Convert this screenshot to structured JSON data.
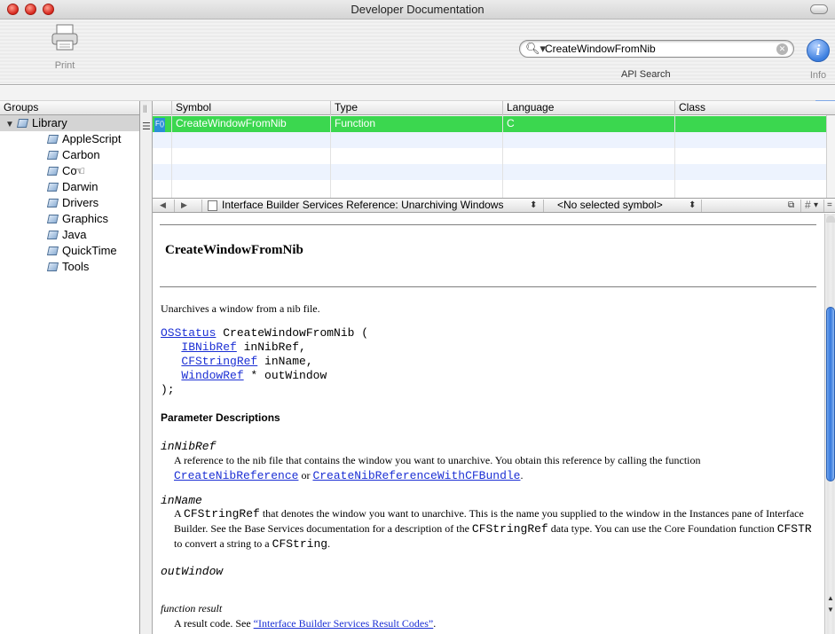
{
  "window": {
    "title": "Developer Documentation"
  },
  "toolbar": {
    "print_label": "Print",
    "search_value": "CreateWindowFromNib",
    "search_label": "API Search",
    "info_label": "Info",
    "info_glyph": "i"
  },
  "groups": {
    "header": "Groups",
    "root": "Library",
    "items": [
      "AppleScript",
      "Carbon",
      "Cocoa",
      "Darwin",
      "Drivers",
      "Graphics",
      "Java",
      "QuickTime",
      "Tools"
    ],
    "cursor_item_visible_text": "Co"
  },
  "results": {
    "columns": [
      "Symbol",
      "Type",
      "Language",
      "Class"
    ],
    "rows": [
      {
        "badge": "F()",
        "symbol": "CreateWindowFromNib",
        "type": "Function",
        "language": "C",
        "class": ""
      }
    ],
    "selected_color": "#3bd74f"
  },
  "navbar": {
    "doc_title": "Interface Builder Services Reference: Unarchiving Windows",
    "symbol_popup": "<No selected symbol>",
    "hash_label": "#"
  },
  "doc": {
    "title": "CreateWindowFromNib",
    "summary": "Unarchives a window from a nib file.",
    "signature": {
      "return_type": "OSStatus",
      "name": "CreateWindowFromNib (",
      "params": [
        {
          "type": "IBNibRef",
          "rest": " inNibRef,"
        },
        {
          "type": "CFStringRef",
          "rest": " inName,"
        },
        {
          "type": "WindowRef",
          "rest": " * outWindow"
        }
      ],
      "close": ");"
    },
    "param_header": "Parameter Descriptions",
    "params": {
      "inNibRef": {
        "name": "inNibRef",
        "text": "A reference to the nib file that contains the window you want to unarchive. You obtain this reference by calling the function",
        "link1": "CreateNibReference",
        "or": " or ",
        "link2": "CreateNibReferenceWithCFBundle",
        "end": "."
      },
      "inName": {
        "name": "inName",
        "t1": "A ",
        "code1": "CFStringRef",
        "t2": " that denotes the window you want to unarchive. This is the name you supplied to the window in the Instances pane of Interface Builder. See the Base Services documentation for a description of the ",
        "code2": "CFStringRef",
        "t3": " data type. You can use the Core Foundation function ",
        "code3": "CFSTR",
        "t4": " to convert a string to a ",
        "code4": "CFString",
        "t5": "."
      },
      "outWindow": {
        "name": "outWindow"
      }
    },
    "function_result": {
      "header": "function result",
      "pre": "A result code. See ",
      "link": "“Interface Builder Services Result Codes”",
      "post": "."
    }
  }
}
